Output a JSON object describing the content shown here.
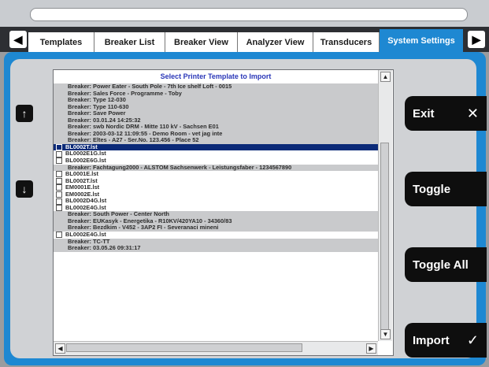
{
  "tabs": [
    {
      "label": "Templates"
    },
    {
      "label": "Breaker List"
    },
    {
      "label": "Breaker View"
    },
    {
      "label": "Analyzer View"
    },
    {
      "label": "Transducers"
    },
    {
      "label": "System Settings"
    }
  ],
  "dialog": {
    "title": "Select Printer Template to Import"
  },
  "rows": [
    {
      "type": "group",
      "text": "Breaker: Power Eater - South Pole - 7th Ice shelf Loft - 0015"
    },
    {
      "type": "group",
      "text": "Breaker: Sales Force - Programme - Toby"
    },
    {
      "type": "group",
      "text": "Breaker: Type 12-030"
    },
    {
      "type": "group",
      "text": "Breaker: Type 110-630"
    },
    {
      "type": "group",
      "text": "Breaker: Save Power"
    },
    {
      "type": "group",
      "text": "Breaker: 03.01.24 14:25:32"
    },
    {
      "type": "group",
      "text": "Breaker: swb Nordic DRM - Mitte 110 kV - Sachsen E01"
    },
    {
      "type": "group",
      "text": "Breaker: 2003-03-12 11:09:55 - Demo Room - vet jag inte"
    },
    {
      "type": "group",
      "text": "Breaker: Eltes - A27 - Ser.No. 123.456 - Place 52"
    },
    {
      "type": "file",
      "text": "BL0002T.lst",
      "selected": true
    },
    {
      "type": "file",
      "text": "BL0002E1G.lst"
    },
    {
      "type": "file",
      "text": "BL0002E6G.lst"
    },
    {
      "type": "group",
      "text": "Breaker: Fachtagung2000 - ALSTOM Sachsenwerk - Leistungsfaber - 1234567890"
    },
    {
      "type": "file",
      "text": "BL0001E.lst"
    },
    {
      "type": "file",
      "text": "BL0002T.lst"
    },
    {
      "type": "file",
      "text": "EM0001E.lst"
    },
    {
      "type": "file",
      "text": "EM0002E.lst"
    },
    {
      "type": "file",
      "text": "BL0002D4G.lst"
    },
    {
      "type": "file",
      "text": "BL0002E4G.lst"
    },
    {
      "type": "group",
      "text": "Breaker: South Power - Center North"
    },
    {
      "type": "group",
      "text": "Breaker: EUKasyk - Energetika - R10KV/420YA10 - 34360/83"
    },
    {
      "type": "group",
      "text": "Breaker: Bezdkim - V452 - 3AP2 FI - Severanaci mineni"
    },
    {
      "type": "file",
      "text": "BL0002E4G.lst"
    },
    {
      "type": "group",
      "text": "Breaker: TC-TT"
    },
    {
      "type": "group",
      "text": "Breaker: 03.05.26 09:31:17"
    }
  ],
  "actions": {
    "exit_label": "Exit",
    "toggle_label": "Toggle",
    "toggle_all_label": "Toggle All",
    "import_label": "Import"
  },
  "icons": {
    "tab_left": "◀",
    "tab_right": "▶",
    "scroll_up": "↑",
    "scroll_down": "↓",
    "close": "✕",
    "check": "✓"
  },
  "colors": {
    "accent": "#1e88d2",
    "selection": "#0b2a78",
    "button": "#0e0e0e"
  }
}
